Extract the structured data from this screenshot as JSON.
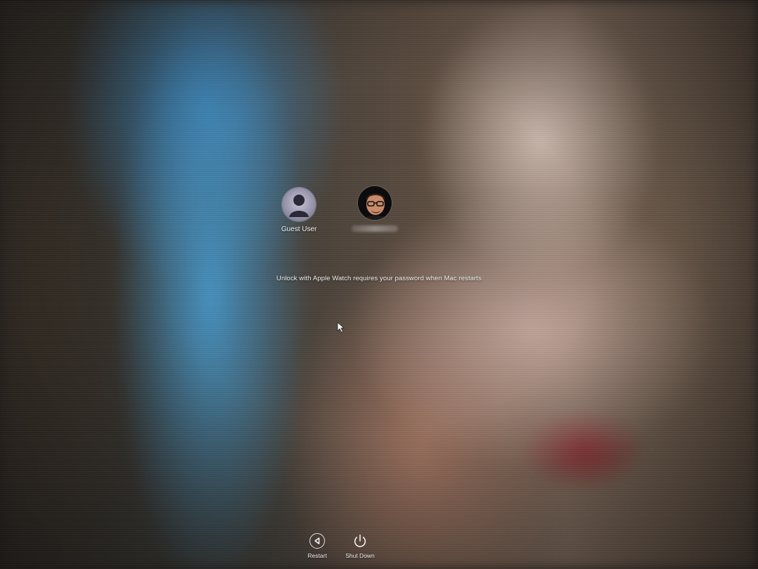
{
  "login_window": {
    "users": [
      {
        "name": "Guest User",
        "avatar_icon": "guest-silhouette-icon"
      },
      {
        "name": "",
        "avatar_icon": "user-photo-avatar",
        "name_obscured": true
      }
    ],
    "message": "Unlock with Apple Watch requires your password when Mac restarts",
    "actions": {
      "restart_label": "Restart",
      "restart_icon": "restart-icon",
      "shutdown_label": "Shut Down",
      "shutdown_icon": "power-icon"
    }
  },
  "colors": {
    "text": "#f0f0f0",
    "guest_avatar": "#8a86a0"
  }
}
